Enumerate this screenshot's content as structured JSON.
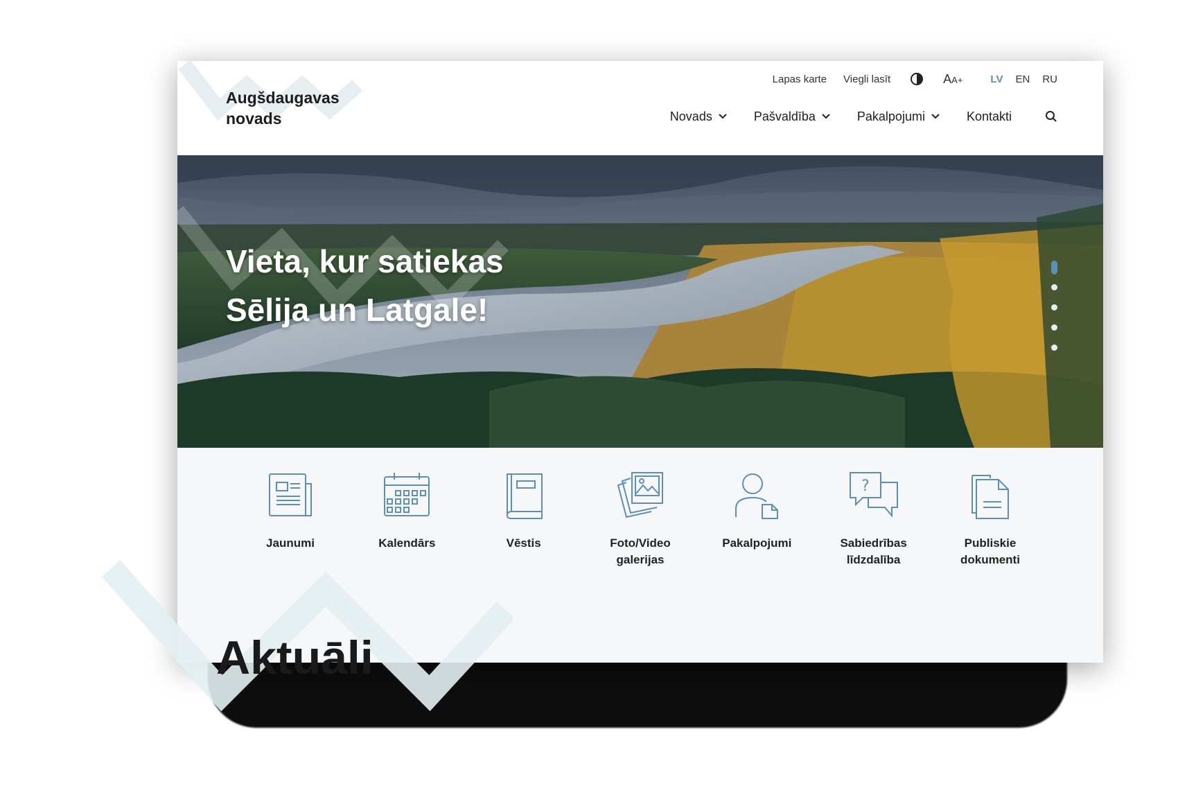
{
  "brand": {
    "name_line1": "Augšdaugavas",
    "name_line2": "novads"
  },
  "utility": {
    "sitemap": "Lapas karte",
    "easy_read": "Viegli lasīt",
    "font_size": "AA+",
    "languages": [
      "LV",
      "EN",
      "RU"
    ],
    "active_language": "LV"
  },
  "nav": {
    "items": [
      {
        "label": "Novads",
        "has_dropdown": true
      },
      {
        "label": "Pašvaldība",
        "has_dropdown": true
      },
      {
        "label": "Pakalpojumi",
        "has_dropdown": true
      },
      {
        "label": "Kontakti",
        "has_dropdown": false
      }
    ]
  },
  "hero": {
    "line1": "Vieta, kur satiekas",
    "line2": "Sēlija un Latgale!",
    "slides_count": 5,
    "active_slide": 1
  },
  "quick_links": [
    {
      "label": "Jaunumi",
      "icon": "newspaper-icon"
    },
    {
      "label": "Kalendārs",
      "icon": "calendar-icon"
    },
    {
      "label": "Vēstis",
      "icon": "book-icon"
    },
    {
      "label": "Foto/Video galerijas",
      "icon": "gallery-icon"
    },
    {
      "label": "Pakalpojumi",
      "icon": "user-document-icon"
    },
    {
      "label": "Sabiedrības līdzdalība",
      "icon": "chat-question-icon"
    },
    {
      "label": "Publiskie dokumenti",
      "icon": "documents-icon"
    }
  ],
  "section": {
    "title": "Aktuāli"
  },
  "colors": {
    "accent": "#5b8fb8",
    "deco": "#e4eef2",
    "text": "#1d1d1d"
  }
}
